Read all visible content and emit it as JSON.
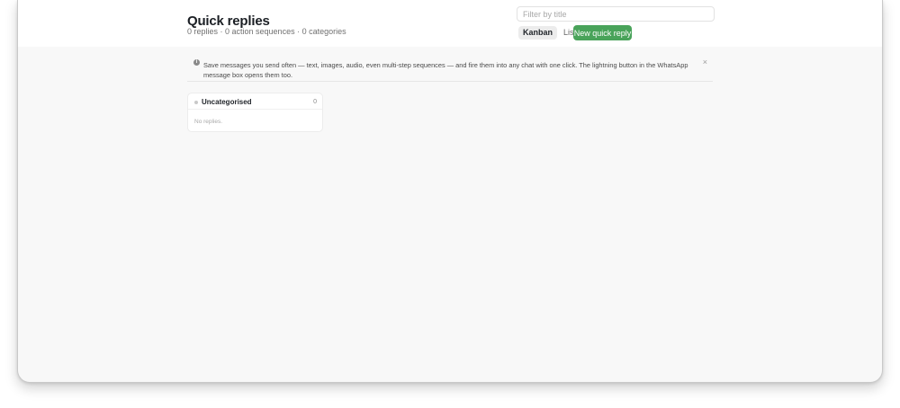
{
  "header": {
    "title": "Quick replies",
    "subtitle": "0 replies · 0 action sequences · 0 categories",
    "filter": {
      "placeholder": "Filter by title",
      "value": ""
    },
    "views": [
      {
        "label": "Kanban",
        "active": true
      },
      {
        "label": "List",
        "active": false
      }
    ],
    "new_button_label": "New quick reply",
    "accent_color": "#49a35a"
  },
  "banner": {
    "icon": "info-icon",
    "text": "Save messages you send often — text, images, audio, even multi-step sequences — and fire them into any chat with one click. The lightning button in the WhatsApp message box opens them too.",
    "close_symbol": "×"
  },
  "columns": [
    {
      "name": "Uncategorised",
      "count": "0",
      "empty_text": "No replies."
    }
  ]
}
